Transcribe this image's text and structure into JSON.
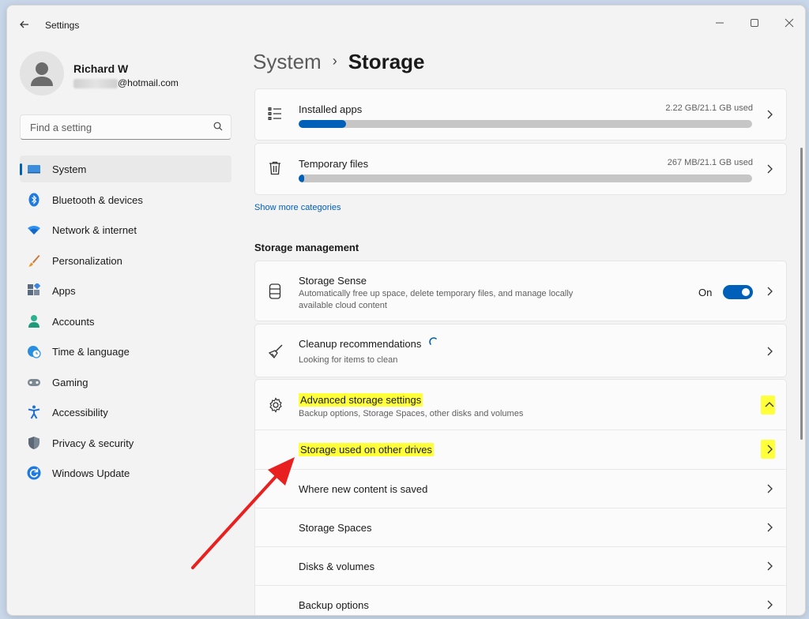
{
  "window": {
    "title": "Settings"
  },
  "profile": {
    "name": "Richard W",
    "email_suffix": "@hotmail.com"
  },
  "search": {
    "placeholder": "Find a setting"
  },
  "nav": [
    {
      "label": "System",
      "icon": "system-icon",
      "selected": true
    },
    {
      "label": "Bluetooth & devices",
      "icon": "bluetooth-icon"
    },
    {
      "label": "Network & internet",
      "icon": "wifi-icon"
    },
    {
      "label": "Personalization",
      "icon": "brush-icon"
    },
    {
      "label": "Apps",
      "icon": "apps-icon"
    },
    {
      "label": "Accounts",
      "icon": "person-icon"
    },
    {
      "label": "Time & language",
      "icon": "globe-clock-icon"
    },
    {
      "label": "Gaming",
      "icon": "gamepad-icon"
    },
    {
      "label": "Accessibility",
      "icon": "accessibility-icon"
    },
    {
      "label": "Privacy & security",
      "icon": "shield-icon"
    },
    {
      "label": "Windows Update",
      "icon": "update-icon"
    }
  ],
  "breadcrumb": {
    "parent": "System",
    "separator": "›",
    "current": "Storage"
  },
  "storage": {
    "installed_apps": {
      "label": "Installed apps",
      "usage": "2.22 GB/21.1 GB used",
      "fraction": 0.105
    },
    "temporary_files": {
      "label": "Temporary files",
      "usage": "267 MB/21.1 GB used",
      "fraction": 0.0127
    },
    "show_more": "Show more categories"
  },
  "management": {
    "title": "Storage management",
    "storage_sense": {
      "title": "Storage Sense",
      "desc": "Automatically free up space, delete temporary files, and manage locally available cloud content",
      "state": "On"
    },
    "cleanup": {
      "title": "Cleanup recommendations",
      "desc": "Looking for items to clean"
    },
    "advanced": {
      "title": "Advanced storage settings",
      "desc": "Backup options, Storage Spaces, other disks and volumes",
      "items": [
        "Storage used on other drives",
        "Where new content is saved",
        "Storage Spaces",
        "Disks & volumes",
        "Backup options"
      ]
    }
  },
  "colors": {
    "accent": "#005fb8",
    "highlight": "#ffff3a",
    "annotation_arrow": "#e8201f"
  }
}
